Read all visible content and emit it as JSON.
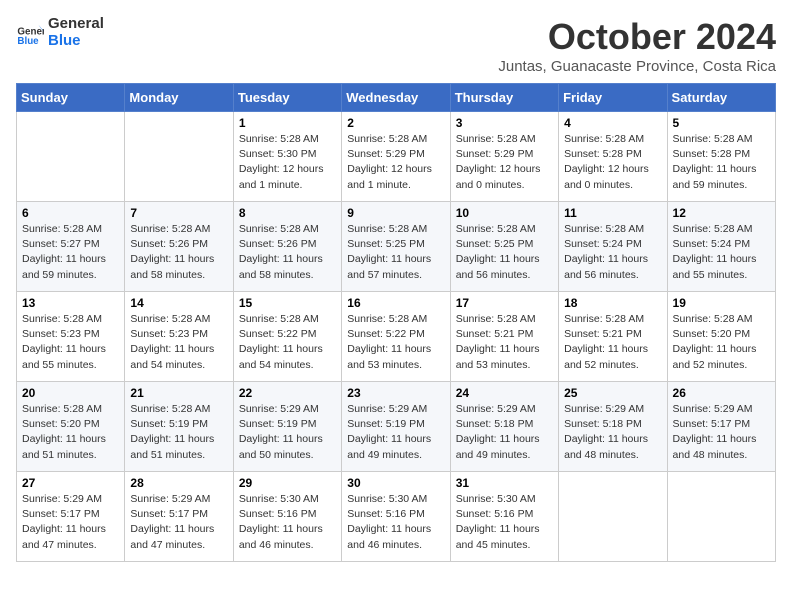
{
  "logo": {
    "line1": "General",
    "line2": "Blue"
  },
  "title": "October 2024",
  "subtitle": "Juntas, Guanacaste Province, Costa Rica",
  "weekdays": [
    "Sunday",
    "Monday",
    "Tuesday",
    "Wednesday",
    "Thursday",
    "Friday",
    "Saturday"
  ],
  "weeks": [
    [
      {
        "day": "",
        "info": ""
      },
      {
        "day": "",
        "info": ""
      },
      {
        "day": "1",
        "info": "Sunrise: 5:28 AM\nSunset: 5:30 PM\nDaylight: 12 hours\nand 1 minute."
      },
      {
        "day": "2",
        "info": "Sunrise: 5:28 AM\nSunset: 5:29 PM\nDaylight: 12 hours\nand 1 minute."
      },
      {
        "day": "3",
        "info": "Sunrise: 5:28 AM\nSunset: 5:29 PM\nDaylight: 12 hours\nand 0 minutes."
      },
      {
        "day": "4",
        "info": "Sunrise: 5:28 AM\nSunset: 5:28 PM\nDaylight: 12 hours\nand 0 minutes."
      },
      {
        "day": "5",
        "info": "Sunrise: 5:28 AM\nSunset: 5:28 PM\nDaylight: 11 hours\nand 59 minutes."
      }
    ],
    [
      {
        "day": "6",
        "info": "Sunrise: 5:28 AM\nSunset: 5:27 PM\nDaylight: 11 hours\nand 59 minutes."
      },
      {
        "day": "7",
        "info": "Sunrise: 5:28 AM\nSunset: 5:26 PM\nDaylight: 11 hours\nand 58 minutes."
      },
      {
        "day": "8",
        "info": "Sunrise: 5:28 AM\nSunset: 5:26 PM\nDaylight: 11 hours\nand 58 minutes."
      },
      {
        "day": "9",
        "info": "Sunrise: 5:28 AM\nSunset: 5:25 PM\nDaylight: 11 hours\nand 57 minutes."
      },
      {
        "day": "10",
        "info": "Sunrise: 5:28 AM\nSunset: 5:25 PM\nDaylight: 11 hours\nand 56 minutes."
      },
      {
        "day": "11",
        "info": "Sunrise: 5:28 AM\nSunset: 5:24 PM\nDaylight: 11 hours\nand 56 minutes."
      },
      {
        "day": "12",
        "info": "Sunrise: 5:28 AM\nSunset: 5:24 PM\nDaylight: 11 hours\nand 55 minutes."
      }
    ],
    [
      {
        "day": "13",
        "info": "Sunrise: 5:28 AM\nSunset: 5:23 PM\nDaylight: 11 hours\nand 55 minutes."
      },
      {
        "day": "14",
        "info": "Sunrise: 5:28 AM\nSunset: 5:23 PM\nDaylight: 11 hours\nand 54 minutes."
      },
      {
        "day": "15",
        "info": "Sunrise: 5:28 AM\nSunset: 5:22 PM\nDaylight: 11 hours\nand 54 minutes."
      },
      {
        "day": "16",
        "info": "Sunrise: 5:28 AM\nSunset: 5:22 PM\nDaylight: 11 hours\nand 53 minutes."
      },
      {
        "day": "17",
        "info": "Sunrise: 5:28 AM\nSunset: 5:21 PM\nDaylight: 11 hours\nand 53 minutes."
      },
      {
        "day": "18",
        "info": "Sunrise: 5:28 AM\nSunset: 5:21 PM\nDaylight: 11 hours\nand 52 minutes."
      },
      {
        "day": "19",
        "info": "Sunrise: 5:28 AM\nSunset: 5:20 PM\nDaylight: 11 hours\nand 52 minutes."
      }
    ],
    [
      {
        "day": "20",
        "info": "Sunrise: 5:28 AM\nSunset: 5:20 PM\nDaylight: 11 hours\nand 51 minutes."
      },
      {
        "day": "21",
        "info": "Sunrise: 5:28 AM\nSunset: 5:19 PM\nDaylight: 11 hours\nand 51 minutes."
      },
      {
        "day": "22",
        "info": "Sunrise: 5:29 AM\nSunset: 5:19 PM\nDaylight: 11 hours\nand 50 minutes."
      },
      {
        "day": "23",
        "info": "Sunrise: 5:29 AM\nSunset: 5:19 PM\nDaylight: 11 hours\nand 49 minutes."
      },
      {
        "day": "24",
        "info": "Sunrise: 5:29 AM\nSunset: 5:18 PM\nDaylight: 11 hours\nand 49 minutes."
      },
      {
        "day": "25",
        "info": "Sunrise: 5:29 AM\nSunset: 5:18 PM\nDaylight: 11 hours\nand 48 minutes."
      },
      {
        "day": "26",
        "info": "Sunrise: 5:29 AM\nSunset: 5:17 PM\nDaylight: 11 hours\nand 48 minutes."
      }
    ],
    [
      {
        "day": "27",
        "info": "Sunrise: 5:29 AM\nSunset: 5:17 PM\nDaylight: 11 hours\nand 47 minutes."
      },
      {
        "day": "28",
        "info": "Sunrise: 5:29 AM\nSunset: 5:17 PM\nDaylight: 11 hours\nand 47 minutes."
      },
      {
        "day": "29",
        "info": "Sunrise: 5:30 AM\nSunset: 5:16 PM\nDaylight: 11 hours\nand 46 minutes."
      },
      {
        "day": "30",
        "info": "Sunrise: 5:30 AM\nSunset: 5:16 PM\nDaylight: 11 hours\nand 46 minutes."
      },
      {
        "day": "31",
        "info": "Sunrise: 5:30 AM\nSunset: 5:16 PM\nDaylight: 11 hours\nand 45 minutes."
      },
      {
        "day": "",
        "info": ""
      },
      {
        "day": "",
        "info": ""
      }
    ]
  ]
}
